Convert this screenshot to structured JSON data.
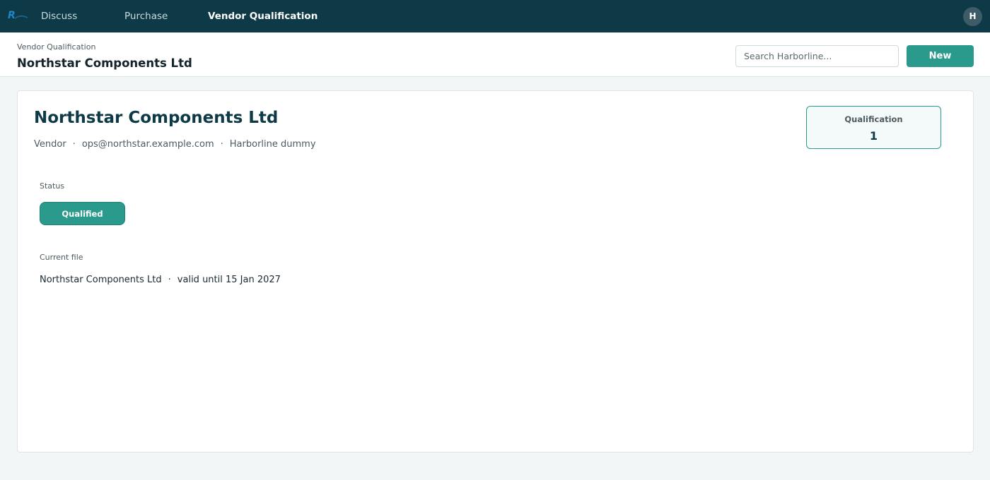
{
  "nav": {
    "logo_icon": "harborline-logo-icon",
    "items": [
      {
        "label": "Discuss",
        "active": false
      },
      {
        "label": "Purchase",
        "active": false
      },
      {
        "label": "Vendor Qualification",
        "active": true
      }
    ],
    "avatar_initial": "H"
  },
  "header": {
    "breadcrumb": "Vendor Qualification",
    "title": "Northstar Components Ltd",
    "search_placeholder": "Search Harborline...",
    "search_value": "",
    "new_button_label": "New"
  },
  "record": {
    "name": "Northstar Components Ltd",
    "meta": {
      "type": "Vendor",
      "email": "ops@northstar.example.com",
      "company": "Harborline dummy",
      "separator": "·"
    },
    "smart_button": {
      "label": "Qualification",
      "count": "1"
    },
    "status": {
      "label": "Status",
      "value": "Qualified"
    },
    "current_file": {
      "label": "Current file",
      "name": "Northstar Components Ltd",
      "separator": "·",
      "validity": "valid until 15 Jan 2027"
    }
  },
  "colors": {
    "topbar": "#0e3a47",
    "accent": "#2a9a8c",
    "title": "#0e3a47",
    "background": "#f2f6f6"
  }
}
